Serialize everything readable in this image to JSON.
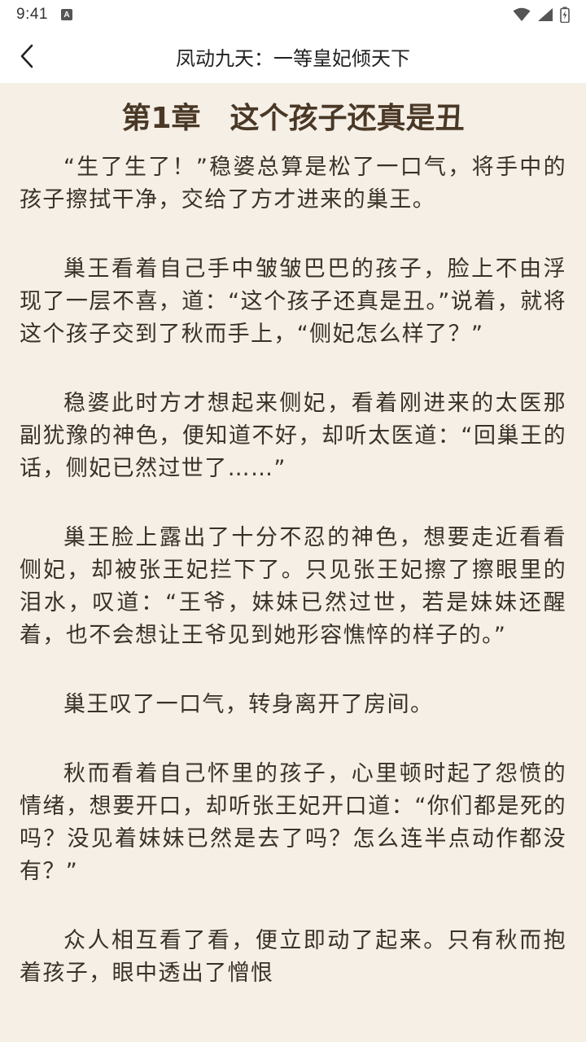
{
  "status_bar": {
    "time": "9:41",
    "notification_icon": "A",
    "icons": [
      "wifi-icon",
      "cell-signal-icon",
      "battery-icon"
    ]
  },
  "header": {
    "title": "凤动九天：一等皇妃倾天下",
    "back_icon": "chevron-left-icon"
  },
  "chapter": {
    "title": "第1章　这个孩子还真是丑",
    "paragraphs": [
      "“生了生了！”稳婆总算是松了一口气，将手中的孩子擦拭干净，交给了方才进来的巢王。",
      "巢王看着自己手中皱皱巴巴的孩子，脸上不由浮现了一层不喜，道：“这个孩子还真是丑。”说着，就将这个孩子交到了秋而手上，“侧妃怎么样了？”",
      "稳婆此时方才想起来侧妃，看着刚进来的太医那副犹豫的神色，便知道不好，却听太医道：“回巢王的话，侧妃已然过世了……”",
      "巢王脸上露出了十分不忍的神色，想要走近看看侧妃，却被张王妃拦下了。只见张王妃擦了擦眼里的泪水，叹道：“王爷，妹妹已然过世，若是妹妹还醒着，也不会想让王爷见到她形容憔悴的样子的。”",
      "巢王叹了一口气，转身离开了房间。",
      "秋而看着自己怀里的孩子，心里顿时起了怨愤的情绪，想要开口，却听张王妃开口道：“你们都是死的吗？没见着妹妹已然是去了吗？怎么连半点动作都没有？”",
      "众人相互看了看，便立即动了起来。只有秋而抱着孩子，眼中透出了憎恨"
    ]
  },
  "colors": {
    "background": "#f5efe6",
    "title_text": "#4a3826",
    "body_text": "#3a3226",
    "header_bg": "#ffffff"
  }
}
